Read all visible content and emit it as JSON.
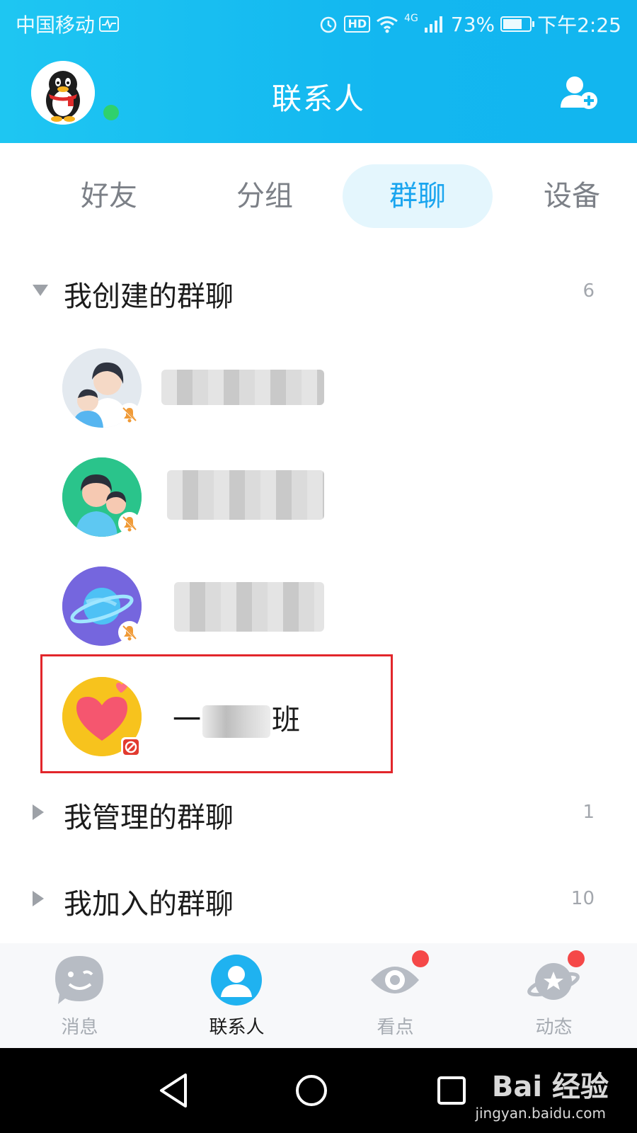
{
  "statusbar": {
    "carrier": "中国移动",
    "network": "4G",
    "hd": "HD",
    "battery": "73%",
    "battery_level": 0.73,
    "time": "下午2:25"
  },
  "header": {
    "title": "联系人"
  },
  "tabs": [
    {
      "label": "好友",
      "active": false
    },
    {
      "label": "分组",
      "active": false
    },
    {
      "label": "群聊",
      "active": true
    },
    {
      "label": "设备",
      "active": false
    }
  ],
  "sections": [
    {
      "label": "我创建的群聊",
      "count": "6",
      "expanded": true
    },
    {
      "label": "我管理的群聊",
      "count": "1",
      "expanded": false
    },
    {
      "label": "我加入的群聊",
      "count": "10",
      "expanded": false
    }
  ],
  "groups": [
    {
      "name_visible": "",
      "blurred": true,
      "muted": true
    },
    {
      "name_visible": "",
      "blurred": true,
      "muted": true
    },
    {
      "name_visible": "",
      "blurred": true,
      "muted": true
    },
    {
      "name_prefix": "一",
      "name_suffix": "班",
      "blurred_middle": true,
      "muted": false
    }
  ],
  "bottom_nav": [
    {
      "label": "消息",
      "active": false,
      "dot": false
    },
    {
      "label": "联系人",
      "active": true,
      "dot": false
    },
    {
      "label": "看点",
      "active": false,
      "dot": true
    },
    {
      "label": "动态",
      "active": false,
      "dot": true
    }
  ],
  "watermark": {
    "logo": "Bai 经验",
    "url": "jingyan.baidu.com"
  },
  "colors": {
    "header": "#13b7f0",
    "accent": "#1aa5ef",
    "highlight": "#e2262b",
    "badge": "#f54848"
  }
}
